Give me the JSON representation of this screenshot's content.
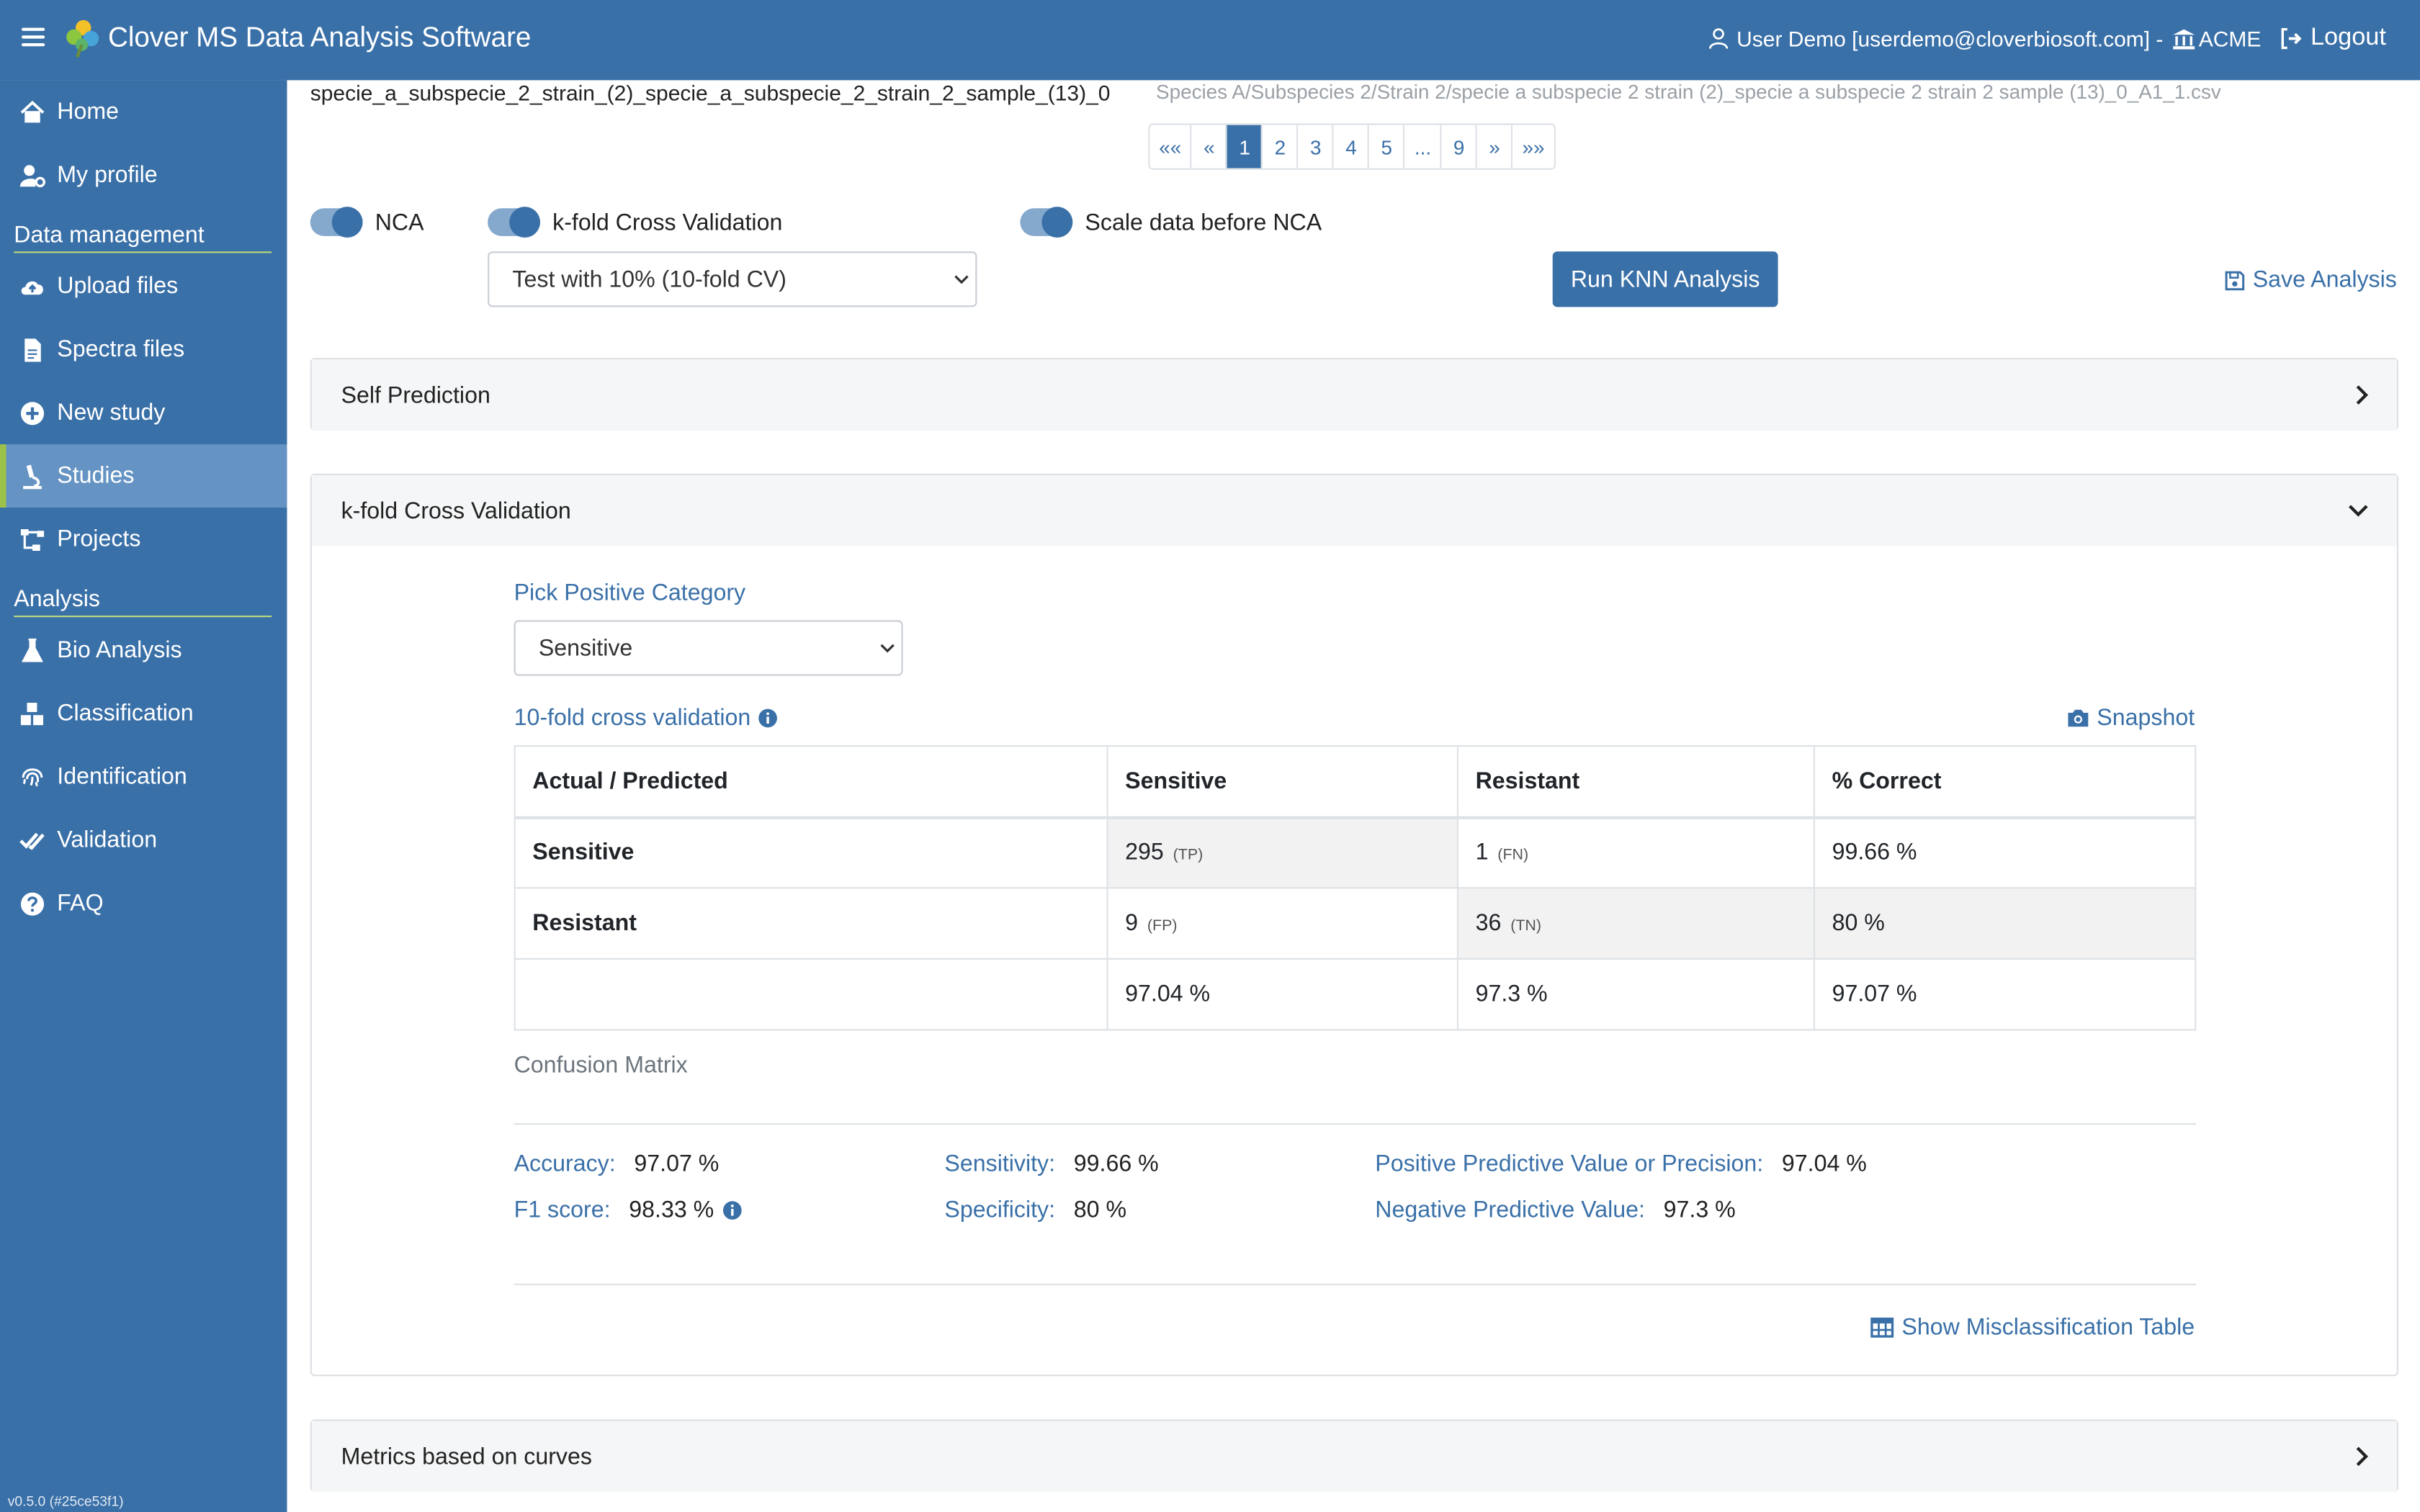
{
  "app": {
    "title": "Clover MS Data Analysis Software",
    "version": "v0.5.0 (#25ce53f1)"
  },
  "header": {
    "user": "User Demo [userdemo@cloverbiosoft.com] -",
    "org": "ACME",
    "logout": "Logout"
  },
  "sidebar": {
    "items": [
      {
        "label": "Home",
        "icon": "home-icon"
      },
      {
        "label": "My profile",
        "icon": "user-gear-icon"
      },
      {
        "label": "Upload files",
        "icon": "cloud-upload-icon"
      },
      {
        "label": "Spectra files",
        "icon": "file-icon"
      },
      {
        "label": "New study",
        "icon": "plus-circle-icon"
      },
      {
        "label": "Studies",
        "icon": "microscope-icon"
      },
      {
        "label": "Projects",
        "icon": "sitemap-icon"
      },
      {
        "label": "Bio Analysis",
        "icon": "flask-icon"
      },
      {
        "label": "Classification",
        "icon": "cubes-icon"
      },
      {
        "label": "Identification",
        "icon": "fingerprint-icon"
      },
      {
        "label": "Validation",
        "icon": "check-double-icon"
      },
      {
        "label": "FAQ",
        "icon": "question-circle-icon"
      }
    ],
    "sections": {
      "data_management": "Data management",
      "analysis": "Analysis"
    }
  },
  "main": {
    "sample_name": "specie_a_subspecie_2_strain_(2)_specie_a_subspecie_2_strain_2_sample_(13)_0",
    "sample_path": "Species A/Subspecies 2/Strain 2/specie a subspecie 2 strain (2)_specie a subspecie 2 strain 2 sample (13)_0_A1_1.csv",
    "pagination": [
      "««",
      "«",
      "1",
      "2",
      "3",
      "4",
      "5",
      "...",
      "9",
      "»",
      "»»"
    ],
    "active_page": "1",
    "toggles": {
      "nca": "NCA",
      "kfold": "k-fold Cross Validation",
      "scale": "Scale data before NCA"
    },
    "cv_select": "Test with 10% (10-fold CV)",
    "run_button": "Run KNN Analysis",
    "save_analysis": "Save Analysis",
    "panels": {
      "self_prediction": "Self Prediction",
      "kfold": "k-fold Cross Validation",
      "curves": "Metrics based on curves"
    },
    "kfold": {
      "pick_label": "Pick Positive Category",
      "pick_value": "Sensitive",
      "cv_title": "10-fold cross validation",
      "snapshot": "Snapshot",
      "table": {
        "headers": [
          "Actual / Predicted",
          "Sensitive",
          "Resistant",
          "% Correct"
        ],
        "rows": [
          {
            "label": "Sensitive",
            "c1": "295",
            "t1": "(TP)",
            "c2": "1",
            "t2": "(FN)",
            "pct": "99.66 %"
          },
          {
            "label": "Resistant",
            "c1": "9",
            "t1": "(FP)",
            "c2": "36",
            "t2": "(TN)",
            "pct": "80 %"
          },
          {
            "label": "",
            "c1": "97.04 %",
            "c2": "97.3 %",
            "pct": "97.07 %"
          }
        ]
      },
      "caption": "Confusion Matrix",
      "metrics": {
        "accuracy_label": "Accuracy:",
        "accuracy": "97.07 %",
        "sensitivity_label": "Sensitivity:",
        "sensitivity": "99.66 %",
        "ppv_label": "Positive Predictive Value or Precision:",
        "ppv": "97.04 %",
        "f1_label": "F1 score:",
        "f1": "98.33 %",
        "specificity_label": "Specificity:",
        "specificity": "80 %",
        "npv_label": "Negative Predictive Value:",
        "npv": "97.3 %"
      },
      "misclass_link": "Show Misclassification Table"
    }
  },
  "colors": {
    "brand": "#3a70a8",
    "active_nav": "#6593c3",
    "accent_green": "#9cc24a"
  }
}
